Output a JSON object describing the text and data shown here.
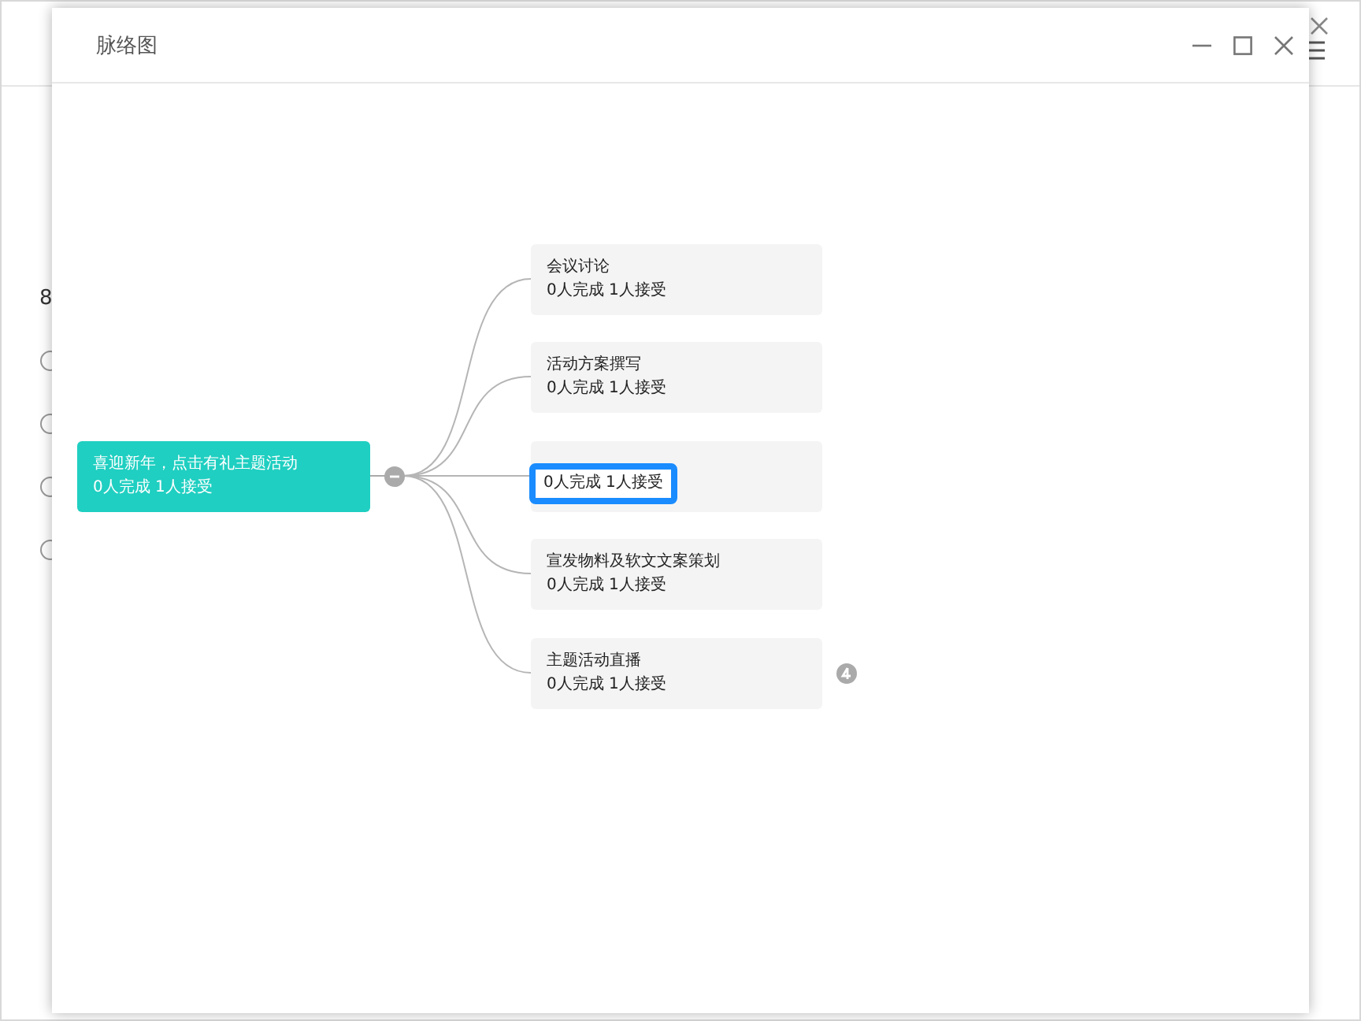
{
  "background": {
    "texts": [
      "8"
    ]
  },
  "dialog": {
    "title": "脉络图"
  },
  "mindmap": {
    "root": {
      "title": "喜迎新年，点击有礼主题活动",
      "stats": "0人完成 1人接受",
      "expanded": true
    },
    "children": [
      {
        "title": "会议讨论",
        "stats": "0人完成 1人接受",
        "highlighted": false,
        "collapsed": false
      },
      {
        "title": "活动方案撰写",
        "stats": "0人完成 1人接受",
        "highlighted": false,
        "collapsed": false
      },
      {
        "stats": "0人完成 1人接受",
        "highlighted": true,
        "collapsed": false
      },
      {
        "title": "宣发物料及软文文案策划",
        "stats": "0人完成 1人接受",
        "highlighted": false,
        "collapsed": false
      },
      {
        "title": "主题活动直播",
        "stats": "0人完成 1人接受",
        "highlighted": false,
        "collapsed": true
      }
    ]
  }
}
